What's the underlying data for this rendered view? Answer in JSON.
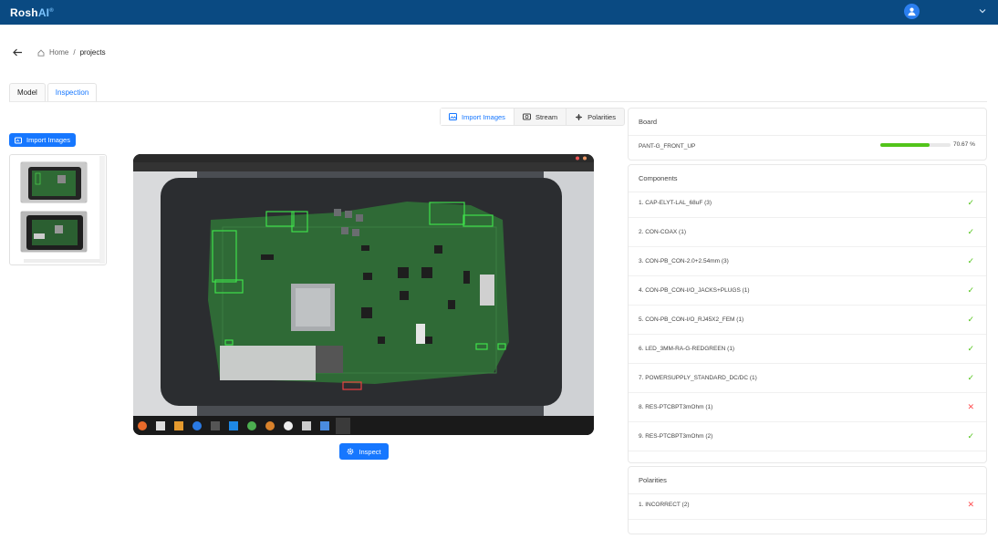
{
  "header": {
    "brand_main": "Rosh",
    "brand_ai": "AI",
    "brand_mark": "®"
  },
  "breadcrumb": {
    "home": "Home",
    "sep": "/",
    "current": "projects"
  },
  "tabs": [
    {
      "label": "Model"
    },
    {
      "label": "Inspection",
      "active": true
    }
  ],
  "mode_buttons": [
    {
      "label": "Import Images",
      "active": true
    },
    {
      "label": "Stream"
    },
    {
      "label": "Polarities"
    }
  ],
  "import_button": "Import Images",
  "inspect_button": "Inspect",
  "board": {
    "title": "Board",
    "name": "PANT-G_FRONT_UP",
    "progress_label": "70.67 %",
    "progress_value": 70.67
  },
  "components": {
    "title": "Components",
    "items": [
      {
        "label": "1. CAP-ELYT-LAL_68uF (3)",
        "status": "ok"
      },
      {
        "label": "2. CON-COAX (1)",
        "status": "ok"
      },
      {
        "label": "3. CON-PB_CON-2.0+2.54mm (3)",
        "status": "ok"
      },
      {
        "label": "4. CON-PB_CON-I/O_JACKS+PLUGS (1)",
        "status": "ok"
      },
      {
        "label": "5. CON-PB_CON-I/O_RJ45X2_FEM (1)",
        "status": "ok"
      },
      {
        "label": "6. LED_3MM-RA-G-REDGREEN (1)",
        "status": "ok"
      },
      {
        "label": "7. POWERSUPPLY_STANDARD_DC/DC (1)",
        "status": "ok"
      },
      {
        "label": "8. RES-PTCBPT3mOhm (1)",
        "status": "bad"
      },
      {
        "label": "9. RES-PTCBPT3mOhm (2)",
        "status": "ok"
      }
    ]
  },
  "polarities": {
    "title": "Polarities",
    "items": [
      {
        "label": "1. INCORRECT (2)",
        "status": "bad"
      }
    ]
  },
  "icons": {
    "ok": "✓",
    "bad": "✕"
  },
  "colors": {
    "header": "#0a4a82",
    "primary": "#1677ff",
    "success": "#52c41a",
    "error": "#ff4d4f"
  }
}
